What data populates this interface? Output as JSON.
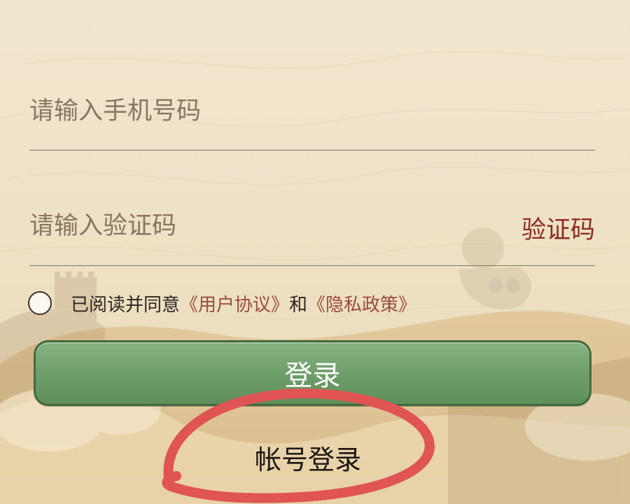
{
  "form": {
    "phone_placeholder": "请输入手机号码",
    "code_placeholder": "请输入验证码",
    "code_button": "验证码"
  },
  "agreement": {
    "prefix": "已阅读并同意",
    "user_agreement": "《用户协议》",
    "and": "和",
    "privacy_policy": "《隐私政策》"
  },
  "buttons": {
    "login": "登录",
    "account_login": "帐号登录"
  },
  "colors": {
    "background": "#f1e6cf",
    "accent_red": "#8d2b24",
    "link": "#9a4d3c",
    "button_green": "#6d9e69",
    "annotation_red": "#e05454"
  }
}
